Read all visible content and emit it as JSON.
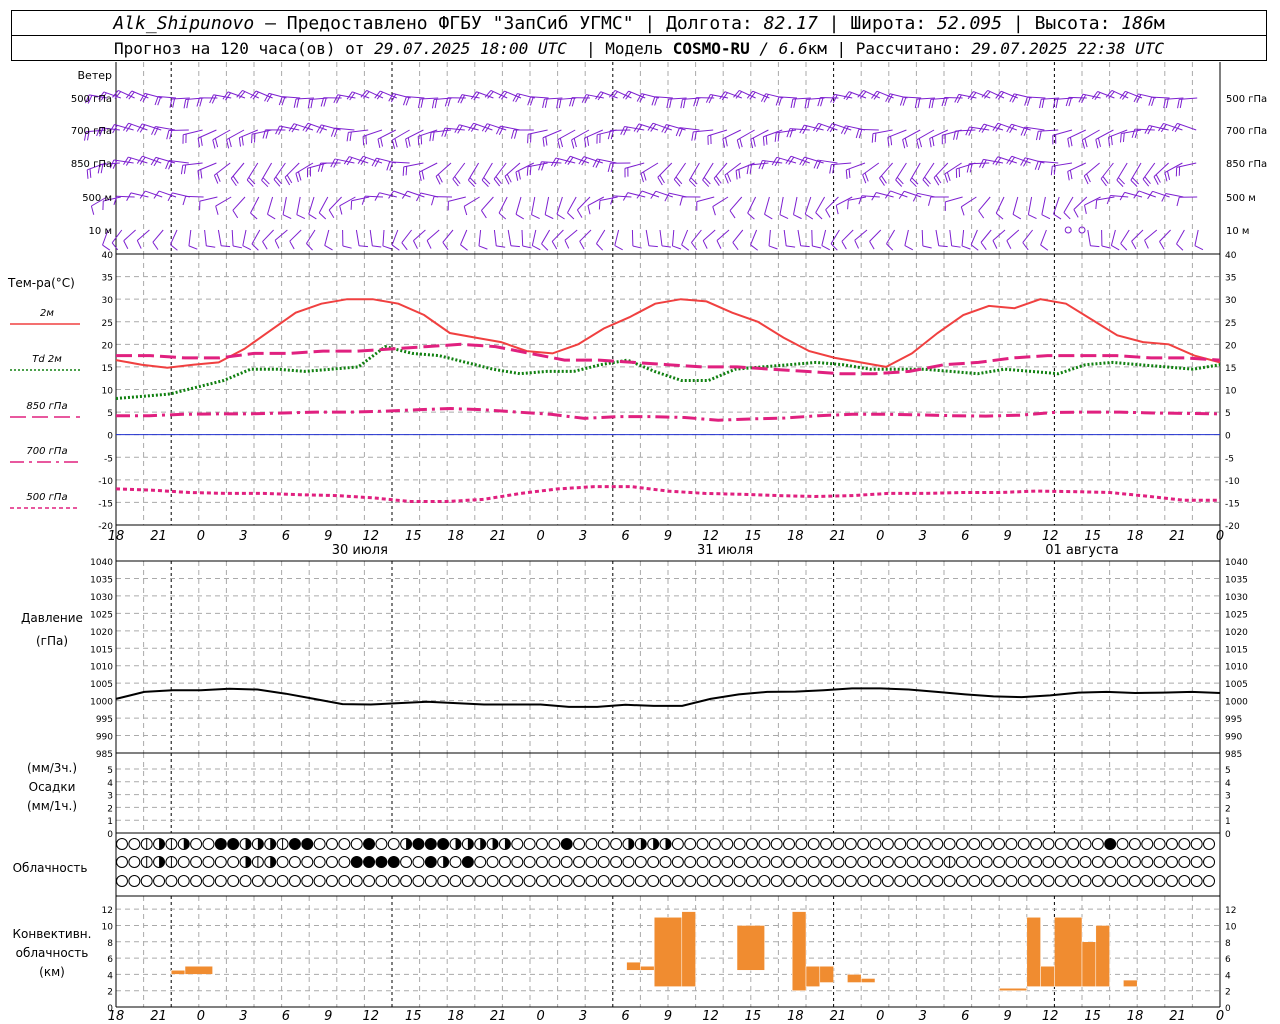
{
  "header": {
    "station": "Alk_Shipunovo",
    "provided_by": "– Предоставлено ФГБУ \"ЗапСиб УГМС\" |",
    "lon_label": "Долгота:",
    "lon": "82.17",
    "lat_label": "| Широта:",
    "lat": "52.095",
    "alt_label": "| Высота:",
    "alt": "186",
    "alt_unit": "м",
    "forecast_label": "Прогноз на 120 часа(ов) от",
    "forecast_time": "29.07.2025 18:00 UTC",
    "model_label": "| Модель",
    "model": "COSMO-RU",
    "resolution": "/ 6.6",
    "res_unit": "км",
    "calc_label": "| Рассчитано:",
    "calc_time": "29.07.2025 22:38 UTC"
  },
  "wind_panel": {
    "title": "Ветер",
    "levels": [
      "500 гПа",
      "700 гПа",
      "850 гПа",
      "500 м",
      "10   м"
    ]
  },
  "temp_panel": {
    "title": "Тем-ра(°С)",
    "legend": [
      {
        "label": "2м",
        "color": "#f04040",
        "dash": "solid"
      },
      {
        "label": "Td  2м",
        "color": "#108010",
        "dash": "dotted"
      },
      {
        "label": "850 гПа",
        "color": "#e0207f",
        "dash": "long"
      },
      {
        "label": "700 гПа",
        "color": "#e0207f",
        "dash": "dashdot"
      },
      {
        "label": "500 гПа",
        "color": "#e0207f",
        "dash": "short"
      }
    ]
  },
  "pressure_panel": {
    "title": "Давление",
    "unit": "(гПа)"
  },
  "precip_panel": {
    "unit3": "(мм/3ч.)",
    "title": "Осадки",
    "unit1": "(мм/1ч.)"
  },
  "cloud_panel": {
    "title": "Облачность"
  },
  "conv_panel": {
    "title1": "Конвективн.",
    "title2": "облачность",
    "unit": "(км)"
  },
  "x_axis": {
    "hour_labels": [
      "18",
      "21",
      "0",
      "3",
      "6",
      "9",
      "12",
      "15",
      "18",
      "21",
      "0",
      "3",
      "6",
      "9",
      "12",
      "15",
      "18",
      "21",
      "0",
      "3",
      "6",
      "9",
      "12",
      "15",
      "18",
      "21",
      "0"
    ],
    "day_labels": [
      "30 июля",
      "31 июля",
      "01 августа"
    ]
  },
  "colors": {
    "wind": "#7d1fd0",
    "t2m": "#f04040",
    "td": "#108010",
    "upper": "#e0207f",
    "upper500": "#e02090",
    "conv": "#f08c30",
    "zero": "#2030d0"
  },
  "chart_data": [
    {
      "type": "line",
      "title": "Тем-ра(°С)",
      "x_hours": [
        0,
        3,
        6,
        9,
        12,
        15,
        18,
        21,
        24,
        27,
        30,
        33,
        36,
        39,
        42,
        45,
        48,
        51,
        54,
        57,
        60,
        63,
        66,
        69,
        72,
        75,
        78,
        81,
        84,
        87,
        90,
        93,
        96,
        99,
        102,
        105,
        108,
        111,
        114,
        117,
        120
      ],
      "ylim": [
        -20,
        40
      ],
      "series": [
        {
          "name": "2м",
          "values": [
            16.5,
            15.5,
            14.8,
            15.5,
            16,
            19,
            23,
            27,
            29,
            30,
            30,
            29,
            26.5,
            22.5,
            21.5,
            20.5,
            18.5,
            18,
            20,
            23.5,
            26,
            29,
            30,
            29.5,
            27,
            25,
            21.5,
            18.5,
            17,
            16,
            15,
            18,
            22.5,
            26.5,
            28.5,
            28,
            30,
            29,
            25.5,
            22,
            20.5,
            20,
            17.5,
            16
          ]
        },
        {
          "name": "Td  2м",
          "values": [
            8,
            8.5,
            9,
            10.5,
            12,
            14.5,
            14.5,
            14,
            14.5,
            15,
            19.5,
            18,
            17.5,
            16,
            14.5,
            13.5,
            14,
            14,
            15.5,
            16.5,
            14,
            12,
            12,
            14.5,
            15,
            15.5,
            16,
            15.5,
            14.5,
            14.5,
            14.5,
            14,
            13.5,
            14.5,
            14,
            13.5,
            15.5,
            16,
            15.5,
            15,
            14.5,
            15.5
          ]
        },
        {
          "name": "850 гПа",
          "values": [
            17.5,
            17.5,
            17,
            17,
            18,
            18,
            18.5,
            18.5,
            19,
            19.5,
            20,
            19.5,
            18,
            16.5,
            16.5,
            16,
            15.5,
            15,
            15,
            14.5,
            14,
            13.5,
            13.5,
            14,
            15.5,
            16,
            17,
            17.5,
            17.5,
            17.5,
            17,
            17,
            16.5
          ]
        },
        {
          "name": "700 гПа",
          "values": [
            4.2,
            4.2,
            4.5,
            4.6,
            4.6,
            4.8,
            5,
            5,
            5.2,
            5.5,
            5.8,
            5.5,
            5,
            4.5,
            3.6,
            4,
            4,
            3.8,
            3.2,
            3.5,
            3.7,
            4.2,
            4.5,
            4.5,
            4.4,
            4.2,
            4.1,
            4.3,
            4.9,
            5,
            5,
            4.8,
            4.7,
            4.6
          ]
        },
        {
          "name": "500 гПа",
          "values": [
            -12,
            -12.3,
            -12.8,
            -13,
            -13,
            -13.3,
            -13.5,
            -14,
            -14.8,
            -14.8,
            -14.3,
            -13,
            -12,
            -11.5,
            -11.5,
            -12.5,
            -13,
            -13.2,
            -13.5,
            -13.7,
            -13.5,
            -13,
            -13,
            -12.8,
            -12.8,
            -12.5,
            -12.6,
            -12.8,
            -13.6,
            -14.5,
            -14.5
          ]
        }
      ]
    },
    {
      "type": "line",
      "title": "Давление",
      "ylim": [
        985,
        1040
      ],
      "series": [
        {
          "name": "Давление",
          "values": [
            1000.5,
            1002.5,
            1003,
            1003,
            1003.4,
            1003.2,
            1002,
            1000.5,
            999,
            998.9,
            999.3,
            999.7,
            999.3,
            998.9,
            998.9,
            998.9,
            998.2,
            998.2,
            998.8,
            998.5,
            998.5,
            1000.5,
            1001.8,
            1002.5,
            1002.6,
            1003,
            1003.5,
            1003.5,
            1003.2,
            1002.5,
            1001.8,
            1001.2,
            1001,
            1001.5,
            1002.3,
            1002.5,
            1002.2,
            1002.3,
            1002.5,
            1002.2
          ]
        }
      ]
    },
    {
      "type": "bar",
      "title": "Конвективн. облачность",
      "ylim": [
        0,
        13
      ],
      "bars": [
        {
          "h0": 6,
          "h1": 7.5,
          "base": 4,
          "top": 4.5
        },
        {
          "h0": 7.5,
          "h1": 10.5,
          "base": 4,
          "top": 5
        },
        {
          "h0": 55.5,
          "h1": 57,
          "base": 4.5,
          "top": 5.5
        },
        {
          "h0": 57,
          "h1": 58.5,
          "base": 4.5,
          "top": 5
        },
        {
          "h0": 58.5,
          "h1": 61.5,
          "base": 2.5,
          "top": 11
        },
        {
          "h0": 61.5,
          "h1": 63,
          "base": 2.5,
          "top": 11.7
        },
        {
          "h0": 67.5,
          "h1": 70.5,
          "base": 4.5,
          "top": 10
        },
        {
          "h0": 73.5,
          "h1": 75,
          "base": 2,
          "top": 11.7
        },
        {
          "h0": 75,
          "h1": 76.5,
          "base": 2.5,
          "top": 5
        },
        {
          "h0": 76.5,
          "h1": 78,
          "base": 3,
          "top": 5
        },
        {
          "h0": 79.5,
          "h1": 81,
          "base": 3,
          "top": 4
        },
        {
          "h0": 81,
          "h1": 82.5,
          "base": 3,
          "top": 3.5
        },
        {
          "h0": 96,
          "h1": 99,
          "base": 2,
          "top": 2.3
        },
        {
          "h0": 99,
          "h1": 100.5,
          "base": 2.5,
          "top": 11
        },
        {
          "h0": 100.5,
          "h1": 102,
          "base": 2.5,
          "top": 5
        },
        {
          "h0": 102,
          "h1": 105,
          "base": 2.5,
          "top": 11
        },
        {
          "h0": 105,
          "h1": 106.5,
          "base": 2.5,
          "top": 8
        },
        {
          "h0": 106.5,
          "h1": 108,
          "base": 2.5,
          "top": 10
        },
        {
          "h0": 109.5,
          "h1": 111,
          "base": 2.5,
          "top": 3.3
        }
      ]
    }
  ],
  "clouds": {
    "upper": "00121200332221330000300233322222000030000222200000000000000000000000000000000000300000000",
    "middle": "00121000002120000003333003203000000000000000000000000000000000000001000000000000000000000",
    "lower": "000000000000000000000000000000000000000000000000000000000000000000000000000000000000000000"
  }
}
